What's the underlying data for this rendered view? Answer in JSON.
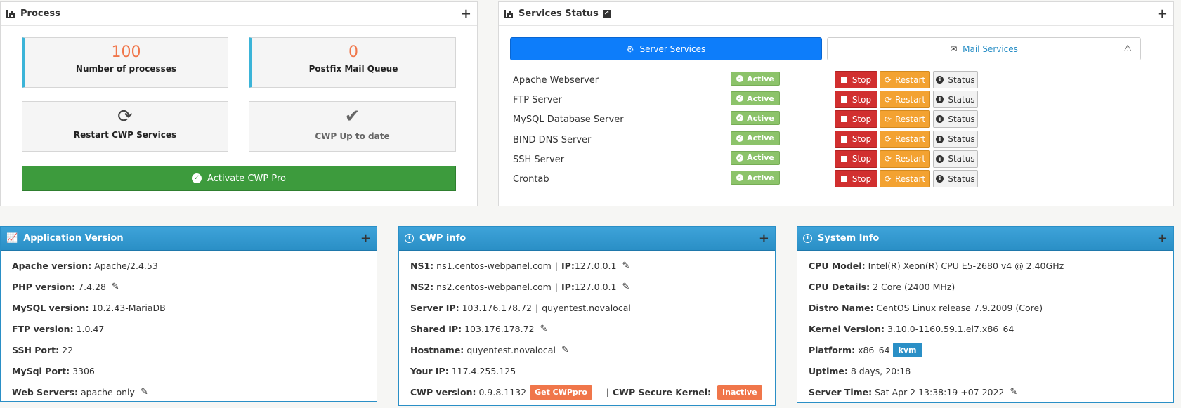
{
  "process": {
    "title": "Process",
    "plus": "+",
    "num_processes": "100",
    "num_processes_label": "Number of processes",
    "mail_queue": "0",
    "mail_queue_label": "Postfix Mail Queue",
    "restart_label": "Restart CWP Services",
    "uptodate_label": "CWP Up to date",
    "activate_label": "Activate CWP Pro"
  },
  "services": {
    "title": "Services Status",
    "plus": "+",
    "tab_server": "Server Services",
    "tab_mail": "Mail Services",
    "rows": [
      {
        "name": "Apache Webserver",
        "status": "Active"
      },
      {
        "name": "FTP Server",
        "status": "Active"
      },
      {
        "name": "MySQL Database Server",
        "status": "Active"
      },
      {
        "name": "BIND DNS Server",
        "status": "Active"
      },
      {
        "name": "SSH Server",
        "status": "Active"
      },
      {
        "name": "Crontab",
        "status": "Active"
      }
    ],
    "stop_label": "Stop",
    "restart_label": "Restart",
    "status_label": "Status"
  },
  "appver": {
    "title": "Application Version",
    "plus": "+",
    "lines": [
      {
        "k": "Apache version:",
        "v": "Apache/2.4.53"
      },
      {
        "k": "PHP version:",
        "v": "7.4.28"
      },
      {
        "k": "MySQL version:",
        "v": "10.2.43-MariaDB"
      },
      {
        "k": "FTP version:",
        "v": "1.0.47"
      },
      {
        "k": "SSH Port:",
        "v": "22"
      },
      {
        "k": "MySql Port:",
        "v": "3306"
      },
      {
        "k": "Web Servers:",
        "v": "apache-only"
      }
    ]
  },
  "cwpinfo": {
    "title": "CWP info",
    "plus": "+",
    "ns1_k": "NS1:",
    "ns1_v": "ns1.centos-webpanel.com",
    "ns1_ip_k": "IP:",
    "ns1_ip_v": "127.0.0.1",
    "ns2_k": "NS2:",
    "ns2_v": "ns2.centos-webpanel.com",
    "ns2_ip_k": "IP:",
    "ns2_ip_v": "127.0.0.1",
    "serverip_k": "Server IP:",
    "serverip_v": "103.176.178.72",
    "serverip_host": "quyentest.novalocal",
    "sharedip_k": "Shared IP:",
    "sharedip_v": "103.176.178.72",
    "hostname_k": "Hostname:",
    "hostname_v": "quyentest.novalocal",
    "yourip_k": "Your IP:",
    "yourip_v": "117.4.255.125",
    "cwpver_k": "CWP version:",
    "cwpver_v": "0.9.8.1132",
    "getpro": "Get CWPpro",
    "kernel_k": "CWP Secure Kernel:",
    "kernel_v": "Inactive",
    "pipe": "|"
  },
  "sysinfo": {
    "title": "System Info",
    "plus": "+",
    "cpu_model_k": "CPU Model:",
    "cpu_model_v": "Intel(R) Xeon(R) CPU E5-2680 v4 @ 2.40GHz",
    "cpu_details_k": "CPU Details:",
    "cpu_details_v": "2 Core (2400 MHz)",
    "distro_k": "Distro Name:",
    "distro_v": "CentOS Linux release 7.9.2009 (Core)",
    "kernel_k": "Kernel Version:",
    "kernel_v": "3.10.0-1160.59.1.el7.x86_64",
    "platform_k": "Platform:",
    "platform_v": "x86_64",
    "platform_badge": "kvm",
    "uptime_k": "Uptime:",
    "uptime_v": "8 days, 20:18",
    "time_k": "Server Time:",
    "time_v": "Sat Apr 2 13:38:19 +07 2022"
  }
}
